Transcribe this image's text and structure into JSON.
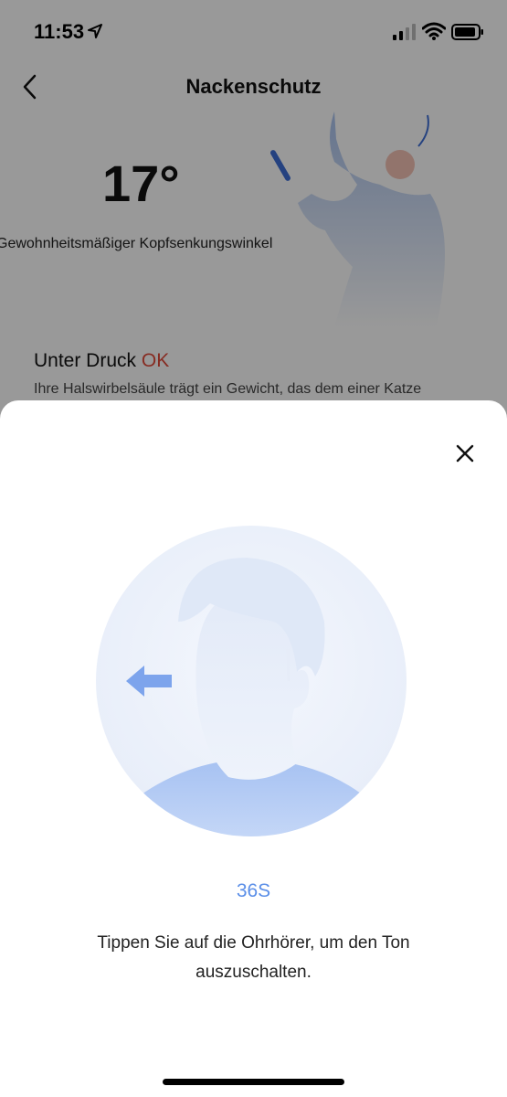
{
  "status_bar": {
    "time": "11:53",
    "icons": [
      "location-arrow-icon",
      "cellular-signal-icon",
      "wifi-icon",
      "battery-icon"
    ]
  },
  "nav": {
    "title": "Nackenschutz",
    "back_icon": "chevron-left-icon"
  },
  "neck": {
    "angle": "17°",
    "angle_label": "Gewohnheitsmäßiger Kopfsenkungswinkel",
    "pressure_title": "Unter Druck",
    "pressure_status": "OK",
    "pressure_desc": "Ihre Halswirbelsäule trägt ein Gewicht, das dem einer Katze"
  },
  "sheet": {
    "close_icon": "close-icon",
    "countdown": "36S",
    "instruction": "Tippen Sie auf die Ohrhörer, um den Ton auszuschalten."
  },
  "colors": {
    "accent": "#5b8fe8",
    "warning": "#e14a3a",
    "overlay": "rgba(0,0,0,0.40)"
  }
}
